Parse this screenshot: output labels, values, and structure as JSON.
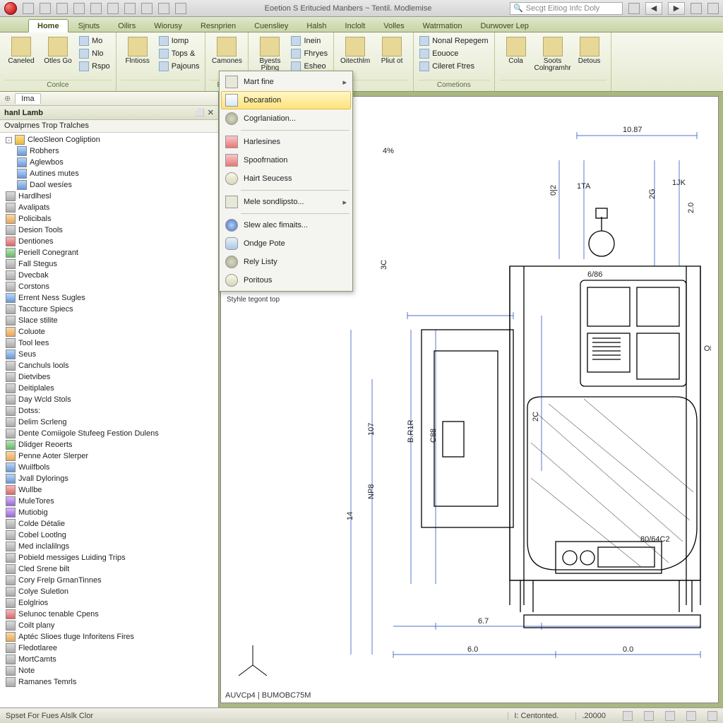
{
  "qat": {
    "title": "Eoetion S Eritucied Manbers ~ Tentil. Modlemise",
    "search_placeholder": "Secgt Eitiog Infc Doly"
  },
  "tabs": [
    "Home",
    "Sjnuts",
    "Oilirs",
    "Wiorusy",
    "Resnprien",
    "Cuensliey",
    "Halsh",
    "Inclolt",
    "Volles",
    "Watrmation",
    "Durwover Lep"
  ],
  "active_tab": 0,
  "ribbon_groups": [
    {
      "label": "Conlce",
      "large": [
        {
          "lbl": "Caneled"
        },
        {
          "lbl": "Otles Go"
        }
      ],
      "small": [
        [
          "Mo",
          "Nlo",
          "Rspo"
        ]
      ]
    },
    {
      "label": "",
      "large": [
        {
          "lbl": "Flntioss"
        }
      ],
      "small": [
        [
          "Iomp",
          "Tops &",
          "Pajouns"
        ]
      ]
    },
    {
      "label": "Eogile",
      "large": [
        {
          "lbl": "Camones"
        }
      ],
      "small": []
    },
    {
      "label": "",
      "large": [
        {
          "lbl": "Byests Pibng"
        }
      ],
      "small": [
        [
          "Inein",
          "Fhryes",
          "Esheo"
        ]
      ]
    },
    {
      "label": "",
      "large": [
        {
          "lbl": "Oitecthlm"
        },
        {
          "lbl": "Pliut ot"
        }
      ],
      "small": []
    },
    {
      "label": "Cometions",
      "large": [],
      "small": [
        [
          "Nonal Repegem",
          "Eouoce",
          "Cileret Ftres"
        ]
      ]
    },
    {
      "label": "",
      "large": [
        {
          "lbl": "Cola"
        },
        {
          "lbl": "Soots Colngramhr"
        },
        {
          "lbl": "Detous"
        }
      ],
      "small": []
    }
  ],
  "side": {
    "tab": "Ima",
    "title": "hanl Lamb",
    "subtitle": "Ovalprnes Trop Tralches",
    "ctrl1": "⬜",
    "ctrl2": "✕"
  },
  "tree": [
    {
      "l": 1,
      "exp": "-",
      "cls": "folder",
      "t": "CleoSleon Cogliption"
    },
    {
      "l": 2,
      "cls": "blue",
      "t": "Robhers"
    },
    {
      "l": 2,
      "cls": "blue",
      "t": "Aglewbos"
    },
    {
      "l": 2,
      "cls": "blue",
      "t": "Autines mutes"
    },
    {
      "l": 2,
      "cls": "blue",
      "t": "Daol wesíes"
    },
    {
      "l": 1,
      "cls": "gray",
      "t": "Hardlhesl"
    },
    {
      "l": 1,
      "cls": "gray",
      "t": "Avalipats"
    },
    {
      "l": 1,
      "cls": "orange",
      "t": "Policibals"
    },
    {
      "l": 1,
      "cls": "gray",
      "t": "Desion Tools"
    },
    {
      "l": 1,
      "cls": "red",
      "t": "Dentiones"
    },
    {
      "l": 1,
      "cls": "green",
      "t": "Periell Conegrant"
    },
    {
      "l": 1,
      "cls": "gray",
      "t": "Fall Stegus"
    },
    {
      "l": 1,
      "cls": "gray",
      "t": "Dvecbak"
    },
    {
      "l": 1,
      "cls": "gray",
      "t": "Corstons"
    },
    {
      "l": 1,
      "cls": "blue",
      "t": "Errent Ness Sugles"
    },
    {
      "l": 1,
      "cls": "gray",
      "t": "Taccture Spiecs"
    },
    {
      "l": 1,
      "cls": "gray",
      "t": "Slace stilite"
    },
    {
      "l": 1,
      "cls": "orange",
      "t": "Coluote"
    },
    {
      "l": 1,
      "cls": "gray",
      "t": "Tool lees"
    },
    {
      "l": 1,
      "cls": "blue",
      "t": "Seus"
    },
    {
      "l": 1,
      "cls": "gray",
      "t": "Canchuls lools"
    },
    {
      "l": 1,
      "cls": "gray",
      "t": "Dietvibes"
    },
    {
      "l": 1,
      "cls": "gray",
      "t": "Deitiplales"
    },
    {
      "l": 1,
      "cls": "gray",
      "t": "Day Wcld Stols"
    },
    {
      "l": 1,
      "cls": "gray",
      "t": "Dotss:"
    },
    {
      "l": 1,
      "cls": "gray",
      "t": "Delim Scrleng"
    },
    {
      "l": 1,
      "cls": "gray",
      "t": "Dente Comiigole Stufeeg Festion Dulens"
    },
    {
      "l": 1,
      "cls": "green",
      "t": "Dlidger Reoerts"
    },
    {
      "l": 1,
      "cls": "orange",
      "t": "Penne Aoter Slerper"
    },
    {
      "l": 1,
      "cls": "blue",
      "t": "Wuilfbols"
    },
    {
      "l": 1,
      "cls": "blue",
      "t": "Jvall Dylorings"
    },
    {
      "l": 1,
      "cls": "red",
      "t": "Wullbe"
    },
    {
      "l": 1,
      "cls": "purple",
      "t": "MuleTores"
    },
    {
      "l": 1,
      "cls": "purple",
      "t": "Mutiobig"
    },
    {
      "l": 1,
      "cls": "gray",
      "t": "Colde Détalie"
    },
    {
      "l": 1,
      "cls": "gray",
      "t": "Cobel Lootlng"
    },
    {
      "l": 1,
      "cls": "gray",
      "t": "Med inclalilngs"
    },
    {
      "l": 1,
      "cls": "gray",
      "t": "Pobield messiges Luiding Trips"
    },
    {
      "l": 1,
      "cls": "gray",
      "t": "Cled Srene bilt"
    },
    {
      "l": 1,
      "cls": "gray",
      "t": "Cory Frelp GrnanTinnes"
    },
    {
      "l": 1,
      "cls": "gray",
      "t": "Colye Suletlon"
    },
    {
      "l": 1,
      "cls": "gray",
      "t": "Eolglrios"
    },
    {
      "l": 1,
      "cls": "red",
      "t": "Selunoc tenable Cpens"
    },
    {
      "l": 1,
      "cls": "gray",
      "t": "Coilt plany"
    },
    {
      "l": 1,
      "cls": "orange",
      "t": "Aptéc Slioes tluge Inforitens Fires"
    },
    {
      "l": 1,
      "cls": "gray",
      "t": "Fledotlaree"
    },
    {
      "l": 1,
      "cls": "gray",
      "t": "MortCamts"
    },
    {
      "l": 1,
      "cls": "gray",
      "t": "Note"
    },
    {
      "l": 1,
      "cls": "gray",
      "t": "Ramanes Temrls"
    }
  ],
  "dropdown": [
    {
      "t": "Mart fine",
      "cls": "folder",
      "arrow": true
    },
    {
      "t": "Decaration",
      "cls": "doc",
      "hl": true
    },
    {
      "t": "Cogrlaniation...",
      "cls": "gear"
    },
    {
      "sep": true
    },
    {
      "t": "Harlesines",
      "cls": "red"
    },
    {
      "t": "Spoofrnation",
      "cls": "red"
    },
    {
      "t": "Hairt Seucess",
      "cls": "search"
    },
    {
      "sep": true
    },
    {
      "t": "Mele sondlipsto...",
      "arrow": true
    },
    {
      "sep": true
    },
    {
      "t": "Slew alec fimaits...",
      "cls": "info"
    },
    {
      "t": "Ondge Pote",
      "cls": "cloud"
    },
    {
      "t": "Rely Listy",
      "cls": "gear"
    },
    {
      "t": "Poritous",
      "cls": "search"
    }
  ],
  "canvas": {
    "under_menu": "Styhle tegont top",
    "dim_top": "10.87",
    "dim_left_pct": "4%",
    "dim_v1": "0|2",
    "dim_v2": "1TA",
    "dim_v3": "2G",
    "dim_v4": "1JK",
    "dim_v5": "2.0",
    "dim_mid_v": "3C",
    "dim_mid_h1": "C88",
    "dim_mid_h2": "2C",
    "dim_mid_h3": "B.R1R",
    "dim_h_y": "14",
    "dim_h_y2": "NP8",
    "dim_h_y3": "107",
    "dim_right": "OK",
    "dim_inner": "6/86",
    "dim_foot": "80/64C2",
    "dim_b1": "6.7",
    "dim_b2": "6.0",
    "dim_b3": "0.0",
    "sheet": "AUVCp4 | BUMOBC75M"
  },
  "status": {
    "left": "Spset For Fues Alslk Clor",
    "center": "I: Centonted.",
    "num": ".20000"
  }
}
